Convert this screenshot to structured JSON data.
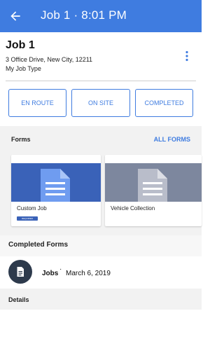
{
  "appbar": {
    "title": "Job 1 · 8:01 PM",
    "back_icon": "arrow-back-icon"
  },
  "job": {
    "title": "Job 1",
    "address": "3 Office Drive, New City, 12211",
    "type": "My Job Type",
    "menu_icon": "more-vert-icon"
  },
  "status_buttons": [
    "EN ROUTE",
    "ON SITE",
    "COMPLETED"
  ],
  "forms_section": {
    "label": "Forms",
    "link": "ALL FORMS",
    "cards": [
      {
        "name": "Custom Job",
        "badge": "REQUIRED",
        "hero_color": "#3a62b8",
        "doc_color": "#6f9cf0"
      },
      {
        "name": "Vehicle Collection",
        "hero_color": "#7d879e",
        "doc_color": "#b9bdca"
      }
    ]
  },
  "completed_forms": {
    "label": "Completed Forms",
    "rows": [
      {
        "title": "Jobs",
        "separator": "·",
        "date": "March 6, 2019",
        "icon": "document-icon"
      }
    ]
  },
  "details": {
    "label": "Details"
  },
  "colors": {
    "accent": "#3f7ce0",
    "section_bg": "#f2f2f2",
    "avatar_bg": "#2d3a4c"
  }
}
